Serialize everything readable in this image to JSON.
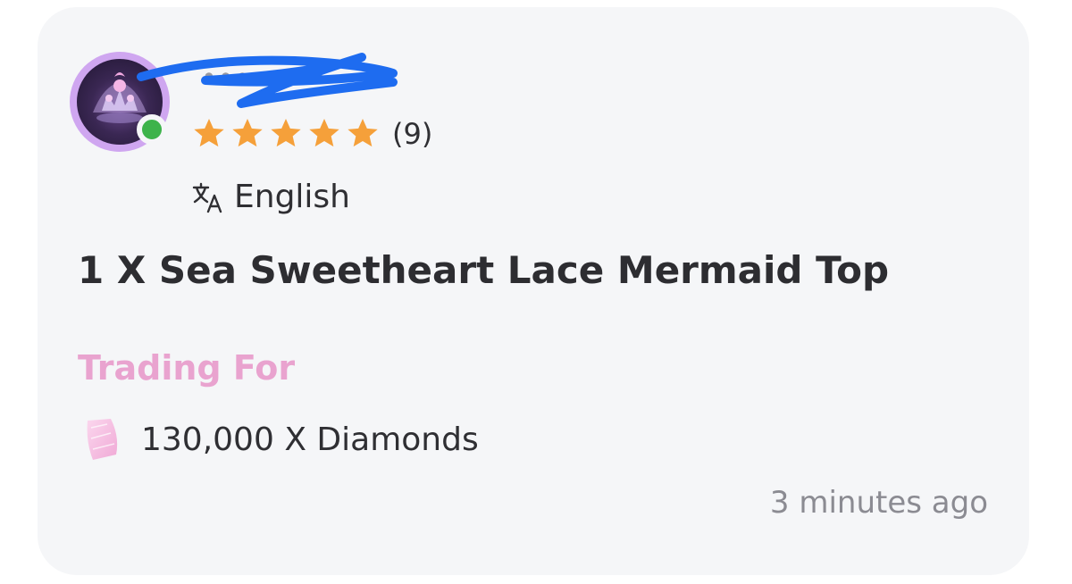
{
  "listing": {
    "username": "••••• ••",
    "rating_count": "(9)",
    "star_count": 5,
    "language": "English",
    "title": "1 X Sea Sweetheart Lace Mermaid Top",
    "trading_for_label": "Trading For",
    "price": "130,000 X Diamonds",
    "timestamp": "3 minutes ago"
  },
  "icons": {
    "avatar": "tiara-avatar",
    "online": "online-status-icon",
    "star": "star-icon",
    "language": "translate-icon",
    "currency": "diamond-icon"
  },
  "colors": {
    "star": "#f5a03a",
    "online": "#3db34b",
    "accent_pink": "#e9a3cf",
    "scribble": "#1e6cf0"
  }
}
